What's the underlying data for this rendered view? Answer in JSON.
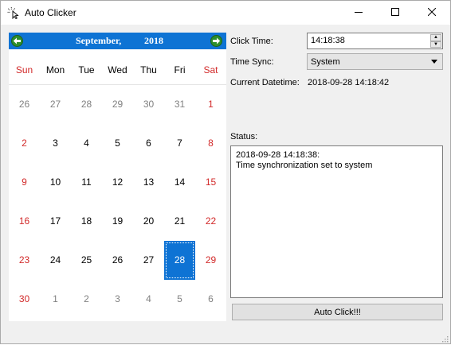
{
  "window": {
    "title": "Auto Clicker",
    "icons": {
      "app": "cursor-click-icon",
      "minimize": "minimize-icon",
      "maximize": "maximize-icon",
      "close": "close-icon"
    }
  },
  "calendar": {
    "month_label": "September,",
    "year_label": "2018",
    "prev_icon": "arrow-left-icon",
    "next_icon": "arrow-right-icon",
    "weekday_headers": [
      "Sun",
      "Mon",
      "Tue",
      "Wed",
      "Thu",
      "Fri",
      "Sat"
    ],
    "weeks": [
      [
        "26",
        "27",
        "28",
        "29",
        "30",
        "31",
        "1"
      ],
      [
        "2",
        "3",
        "4",
        "5",
        "6",
        "7",
        "8"
      ],
      [
        "9",
        "10",
        "11",
        "12",
        "13",
        "14",
        "15"
      ],
      [
        "16",
        "17",
        "18",
        "19",
        "20",
        "21",
        "22"
      ],
      [
        "23",
        "24",
        "25",
        "26",
        "27",
        "28",
        "29"
      ],
      [
        "30",
        "1",
        "2",
        "3",
        "4",
        "5",
        "6"
      ]
    ],
    "selected_day": "28",
    "colors": {
      "header_bg": "#0e73d4",
      "weekend": "#d22a2a",
      "other_month": "#808080",
      "selected_bg": "#0e73d4"
    }
  },
  "form": {
    "click_time_label": "Click Time:",
    "click_time_value": "14:18:38",
    "time_sync_label": "Time Sync:",
    "time_sync_value": "System",
    "current_datetime_label": "Current Datetime:",
    "current_datetime_value": "2018-09-28 14:18:42"
  },
  "status": {
    "label": "Status:",
    "lines": [
      "2018-09-28 14:18:38:",
      "Time synchronization set to system"
    ]
  },
  "actions": {
    "auto_click_label": "Auto Click!!!"
  }
}
